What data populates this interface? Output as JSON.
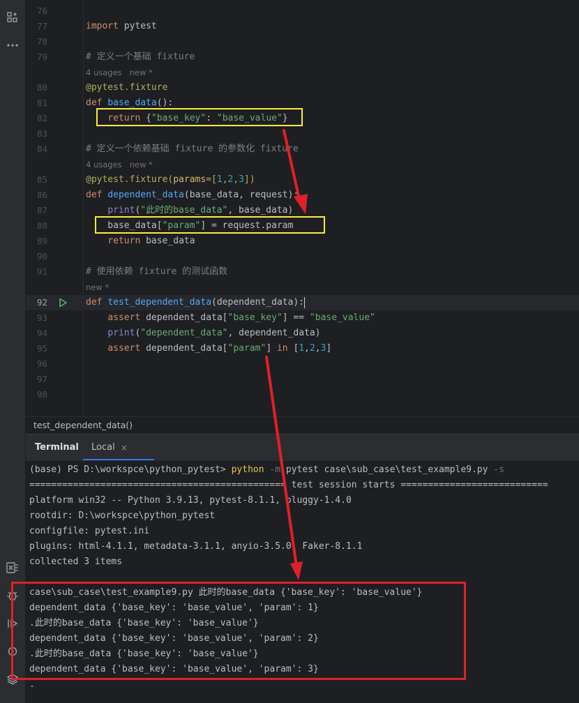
{
  "editor": {
    "lines": [
      {
        "n": "76",
        "segs": []
      },
      {
        "n": "77",
        "segs": [
          {
            "c": "kw",
            "t": "import"
          },
          {
            "c": "plain",
            "t": " pytest"
          }
        ]
      },
      {
        "n": "78",
        "segs": []
      },
      {
        "n": "79",
        "segs": [
          {
            "c": "cm",
            "t": "# 定义一个基础 fixture"
          }
        ]
      },
      {
        "hint": "4 usages   new *"
      },
      {
        "n": "80",
        "segs": [
          {
            "c": "dec",
            "t": "@pytest.fixture"
          }
        ]
      },
      {
        "n": "81",
        "segs": [
          {
            "c": "kw",
            "t": "def "
          },
          {
            "c": "fn",
            "t": "base_data"
          },
          {
            "c": "plain",
            "t": "():"
          }
        ]
      },
      {
        "n": "82",
        "segs": [
          {
            "c": "plain",
            "t": "    "
          },
          {
            "c": "kw",
            "t": "return "
          },
          {
            "c": "plain",
            "t": "{"
          },
          {
            "c": "str",
            "t": "\"base_key\""
          },
          {
            "c": "plain",
            "t": ": "
          },
          {
            "c": "str",
            "t": "\"base_value\""
          },
          {
            "c": "plain",
            "t": "}"
          }
        ]
      },
      {
        "n": "83",
        "segs": []
      },
      {
        "n": "84",
        "segs": [
          {
            "c": "cm",
            "t": "# 定义一个依赖基础 fixture 的参数化 fixture"
          }
        ]
      },
      {
        "hint": "4 usages   new *"
      },
      {
        "n": "85",
        "segs": [
          {
            "c": "dec",
            "t": "@pytest.fixture("
          },
          {
            "c": "prm",
            "t": "params"
          },
          {
            "c": "dec",
            "t": "=["
          },
          {
            "c": "num",
            "t": "1"
          },
          {
            "c": "dec",
            "t": ","
          },
          {
            "c": "num",
            "t": "2"
          },
          {
            "c": "dec",
            "t": ","
          },
          {
            "c": "num",
            "t": "3"
          },
          {
            "c": "dec",
            "t": "])"
          }
        ]
      },
      {
        "n": "86",
        "segs": [
          {
            "c": "kw",
            "t": "def "
          },
          {
            "c": "fn",
            "t": "dependent_data"
          },
          {
            "c": "plain",
            "t": "(base_data, request):"
          }
        ]
      },
      {
        "n": "87",
        "segs": [
          {
            "c": "plain",
            "t": "    "
          },
          {
            "c": "bi",
            "t": "print"
          },
          {
            "c": "plain",
            "t": "("
          },
          {
            "c": "str",
            "t": "\"此时的base_data\""
          },
          {
            "c": "plain",
            "t": ", base_data)"
          }
        ]
      },
      {
        "n": "88",
        "segs": [
          {
            "c": "plain",
            "t": "    base_data["
          },
          {
            "c": "str",
            "t": "\"param\""
          },
          {
            "c": "plain",
            "t": "] = request.param"
          }
        ]
      },
      {
        "n": "89",
        "segs": [
          {
            "c": "plain",
            "t": "    "
          },
          {
            "c": "kw",
            "t": "return "
          },
          {
            "c": "plain",
            "t": "base_data"
          }
        ]
      },
      {
        "n": "90",
        "segs": []
      },
      {
        "n": "91",
        "segs": [
          {
            "c": "cm",
            "t": "# 使用依赖 fixture 的测试函数"
          }
        ]
      },
      {
        "hint": "new *"
      },
      {
        "n": "92",
        "current": true,
        "run": true,
        "caret": true,
        "segs": [
          {
            "c": "kw",
            "t": "def "
          },
          {
            "c": "fn",
            "t": "test_dependent_data"
          },
          {
            "c": "plain",
            "t": "(dependent_data):"
          }
        ]
      },
      {
        "n": "93",
        "segs": [
          {
            "c": "plain",
            "t": "    "
          },
          {
            "c": "kw",
            "t": "assert "
          },
          {
            "c": "plain",
            "t": "dependent_data["
          },
          {
            "c": "str",
            "t": "\"base_key\""
          },
          {
            "c": "plain",
            "t": "] == "
          },
          {
            "c": "str",
            "t": "\"base_value\""
          }
        ]
      },
      {
        "n": "94",
        "segs": [
          {
            "c": "plain",
            "t": "    "
          },
          {
            "c": "bi",
            "t": "print"
          },
          {
            "c": "plain",
            "t": "("
          },
          {
            "c": "str",
            "t": "\"dependent_data\""
          },
          {
            "c": "plain",
            "t": ", dependent_data)"
          }
        ]
      },
      {
        "n": "95",
        "segs": [
          {
            "c": "plain",
            "t": "    "
          },
          {
            "c": "kw",
            "t": "assert "
          },
          {
            "c": "plain",
            "t": "dependent_data["
          },
          {
            "c": "str",
            "t": "\"param\""
          },
          {
            "c": "plain",
            "t": "] "
          },
          {
            "c": "kw",
            "t": "in "
          },
          {
            "c": "plain",
            "t": "["
          },
          {
            "c": "num",
            "t": "1"
          },
          {
            "c": "plain",
            "t": ","
          },
          {
            "c": "num",
            "t": "2"
          },
          {
            "c": "plain",
            "t": ","
          },
          {
            "c": "num",
            "t": "3"
          },
          {
            "c": "plain",
            "t": "]"
          }
        ]
      },
      {
        "n": "96",
        "segs": []
      },
      {
        "n": "97",
        "segs": []
      },
      {
        "n": "98",
        "segs": []
      }
    ]
  },
  "breadcrumb": "test_dependent_data()",
  "terminal_tabs": {
    "terminal_label": "Terminal",
    "local_label": "Local",
    "close_glyph": "×"
  },
  "terminal": {
    "lines": [
      {
        "segs": [
          {
            "c": "plain",
            "t": "(base) PS D:\\workspce\\python_pytest> "
          },
          {
            "c": "cmd",
            "t": "python"
          },
          {
            "c": "flag",
            "t": " -m "
          },
          {
            "c": "plain",
            "t": "pytest case\\sub_case\\test_example9.py "
          },
          {
            "c": "flag",
            "t": "-s"
          }
        ]
      },
      {
        "segs": [
          {
            "c": "plain",
            "t": "=============================================== test session starts ==========================="
          }
        ]
      },
      {
        "segs": [
          {
            "c": "plain",
            "t": "platform win32 -- Python 3.9.13, pytest-8.1.1, pluggy-1.4.0"
          }
        ]
      },
      {
        "segs": [
          {
            "c": "plain",
            "t": "rootdir: D:\\workspce\\python_pytest"
          }
        ]
      },
      {
        "segs": [
          {
            "c": "plain",
            "t": "configfile: pytest.ini"
          }
        ]
      },
      {
        "segs": [
          {
            "c": "plain",
            "t": "plugins: html-4.1.1, metadata-3.1.1, anyio-3.5.0, Faker-8.1.1"
          }
        ]
      },
      {
        "segs": [
          {
            "c": "plain",
            "t": "collected 3 items"
          }
        ]
      },
      {
        "segs": []
      },
      {
        "segs": [
          {
            "c": "plain",
            "t": "case\\sub_case\\test_example9.py 此时的base_data {'base_key': 'base_value'}"
          }
        ]
      },
      {
        "segs": [
          {
            "c": "plain",
            "t": "dependent_data {'base_key': 'base_value', 'param': 1}"
          }
        ]
      },
      {
        "segs": [
          {
            "c": "plain",
            "t": ".此时的base_data {'base_key': 'base_value'}"
          }
        ]
      },
      {
        "segs": [
          {
            "c": "plain",
            "t": "dependent_data {'base_key': 'base_value', 'param': 2}"
          }
        ]
      },
      {
        "segs": [
          {
            "c": "plain",
            "t": ".此时的base_data {'base_key': 'base_value'}"
          }
        ]
      },
      {
        "segs": [
          {
            "c": "plain",
            "t": "dependent_data {'base_key': 'base_value', 'param': 3}"
          }
        ]
      },
      {
        "segs": [
          {
            "c": "plain",
            "t": "."
          }
        ]
      }
    ]
  },
  "icons": {
    "project": "project-structure-icon",
    "more": "more-icon",
    "excel": "excel-icon",
    "debug": "debug-icon",
    "run_panel": "run-panel-icon",
    "services": "services-icon",
    "layers": "layers-icon",
    "run_gutter": "run-gutter-icon"
  },
  "colors": {
    "annotation_yellow": "#ffeb3b",
    "annotation_red": "#e0202a",
    "accent": "#3574f0"
  }
}
